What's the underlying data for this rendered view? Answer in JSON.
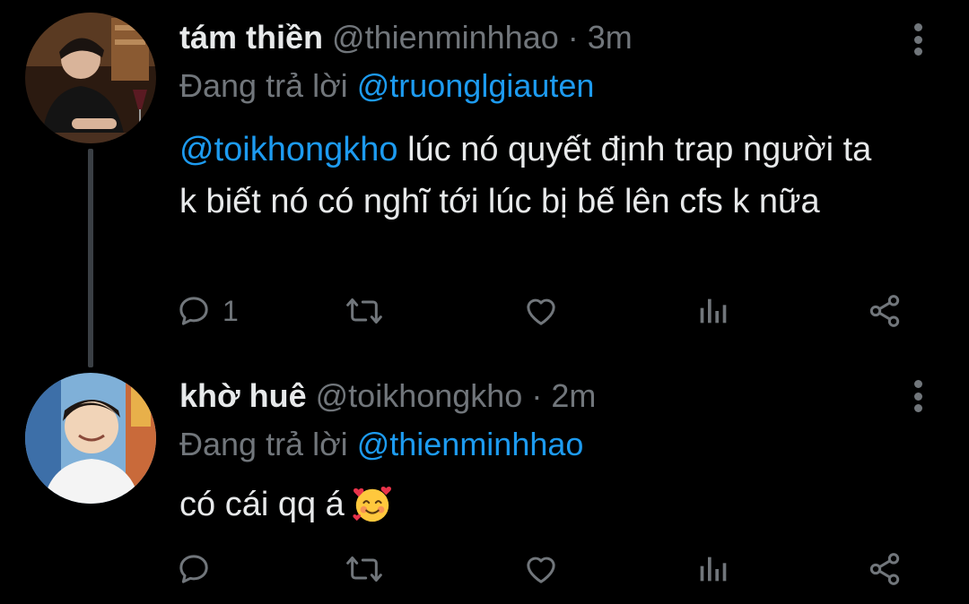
{
  "tweets": [
    {
      "display_name": "tám thiền",
      "handle": "@thienminhhao",
      "separator": "·",
      "time": "3m",
      "reply_prefix": "Đang trả lời",
      "reply_to": "@truonglgiauten",
      "mention": "@toikhongkho",
      "text": " lúc nó quyết định trap người ta k biết nó có nghĩ tới lúc bị bế lên cfs k nữa",
      "reply_count": "1",
      "avatar_colors": [
        "#2b1a10",
        "#8a5a32"
      ]
    },
    {
      "display_name": "khờ huê",
      "handle": "@toikhongkho",
      "separator": "·",
      "time": "2m",
      "reply_prefix": "Đang trả lời",
      "reply_to": "@thienminhhao",
      "text": "có cái qq á",
      "emoji": "smiling-face-with-hearts",
      "reply_count": "",
      "avatar_colors": [
        "#7fb0d8",
        "#f1d4b8"
      ]
    }
  ],
  "icons": {
    "reply": "reply-icon",
    "retweet": "retweet-icon",
    "like": "heart-icon",
    "views": "views-icon",
    "share": "share-icon",
    "more": "more-vertical-icon"
  },
  "colors": {
    "background": "#000000",
    "text": "#e7e9ea",
    "secondary": "#71767b",
    "mention": "#1d9bf0"
  }
}
